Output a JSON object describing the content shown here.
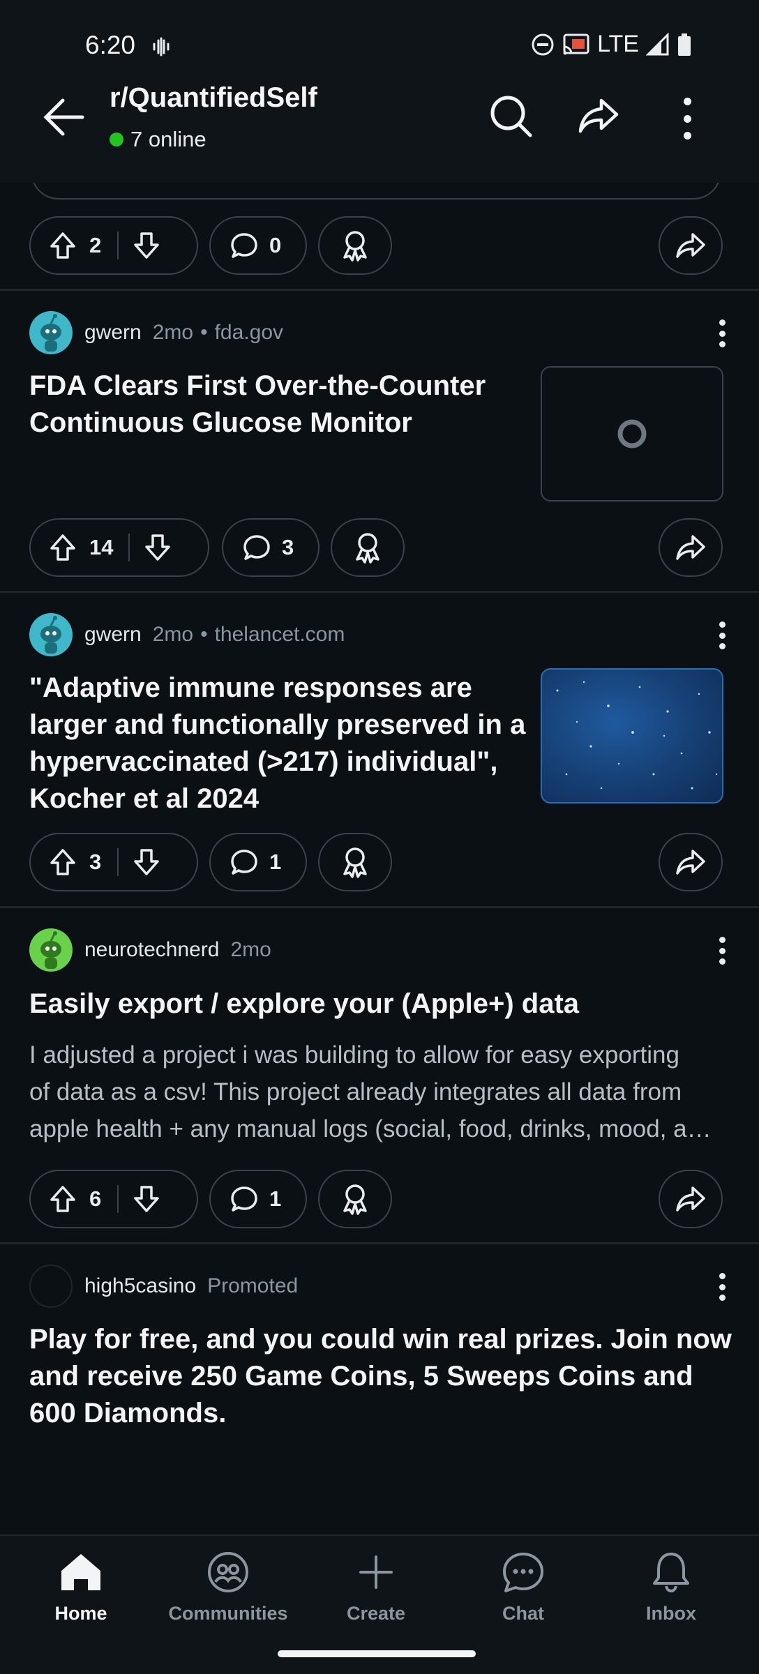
{
  "status_bar": {
    "time": "6:20",
    "network": "LTE"
  },
  "header": {
    "subreddit": "r/QuantifiedSelf",
    "online": "7 online",
    "online_color": "#22c51e"
  },
  "top_post_actions": {
    "upvotes": "2",
    "comments": "0"
  },
  "posts": [
    {
      "author": "gwern",
      "age": "2mo",
      "domain": "fda.gov",
      "title_lines": [
        "FDA Clears First Over-the-Counter",
        "Continuous Glucose Monitor"
      ],
      "thumbnail": "loading-placeholder",
      "upvotes": "14",
      "comments": "3"
    },
    {
      "author": "gwern",
      "age": "2mo",
      "domain": "thelancet.com",
      "title_lines": [
        "\"Adaptive immune responses are",
        "larger and functionally preserved in a",
        "hypervaccinated (>217) individual\",",
        "Kocher et al 2024"
      ],
      "thumbnail": "starry-blue-image",
      "upvotes": "3",
      "comments": "1"
    },
    {
      "author": "neurotechnerd",
      "age": "2mo",
      "title": "Easily export / explore your (Apple+) data",
      "body_lines": [
        "I adjusted a project i was building to allow for easy exporting",
        "of data as a csv! This project already integrates all data from",
        "apple health + any manual logs (social, food, drinks, mood, a…"
      ],
      "upvotes": "6",
      "comments": "1"
    },
    {
      "author": "high5casino",
      "label": "Promoted",
      "title_lines": [
        "Play for free, and you could win real prizes. Join now",
        "and receive 250 Game Coins, 5 Sweeps Coins and",
        "600 Diamonds."
      ]
    }
  ],
  "bottom_nav": [
    {
      "label": "Home",
      "icon": "home-icon",
      "active": true
    },
    {
      "label": "Communities",
      "icon": "communities-icon",
      "active": false
    },
    {
      "label": "Create",
      "icon": "plus-icon",
      "active": false
    },
    {
      "label": "Chat",
      "icon": "chat-icon",
      "active": false
    },
    {
      "label": "Inbox",
      "icon": "bell-icon",
      "active": false
    }
  ],
  "colors": {
    "background": "#0b1015",
    "avatar_teal": "#3fb8c9",
    "avatar_green": "#6ad14a",
    "thumbnail_blue": "#1a4a85"
  }
}
